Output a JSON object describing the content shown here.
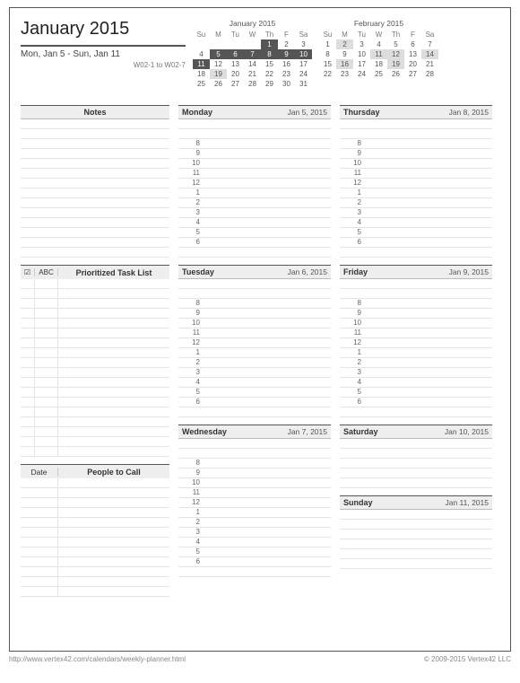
{
  "title": "January 2015",
  "date_range": "Mon, Jan 5  -  Sun, Jan 11",
  "week_numbers": "W02-1 to W02-7",
  "minicals": [
    {
      "title": "January 2015",
      "dow": [
        "Su",
        "M",
        "Tu",
        "W",
        "Th",
        "F",
        "Sa"
      ],
      "rows": [
        [
          "",
          "",
          "",
          "",
          "1",
          "2",
          "3"
        ],
        [
          "4",
          "5",
          "6",
          "7",
          "8",
          "9",
          "10"
        ],
        [
          "11",
          "12",
          "13",
          "14",
          "15",
          "16",
          "17"
        ],
        [
          "18",
          "19",
          "20",
          "21",
          "22",
          "23",
          "24"
        ],
        [
          "25",
          "26",
          "27",
          "28",
          "29",
          "30",
          "31"
        ]
      ],
      "hl_dark": [
        [
          0,
          4
        ],
        [
          1,
          1
        ],
        [
          1,
          2
        ],
        [
          1,
          3
        ],
        [
          1,
          4
        ],
        [
          1,
          5
        ],
        [
          1,
          6
        ],
        [
          2,
          0
        ]
      ],
      "hl_light": [
        [
          3,
          1
        ]
      ]
    },
    {
      "title": "February 2015",
      "dow": [
        "Su",
        "M",
        "Tu",
        "W",
        "Th",
        "F",
        "Sa"
      ],
      "rows": [
        [
          "1",
          "2",
          "3",
          "4",
          "5",
          "6",
          "7"
        ],
        [
          "8",
          "9",
          "10",
          "11",
          "12",
          "13",
          "14"
        ],
        [
          "15",
          "16",
          "17",
          "18",
          "19",
          "20",
          "21"
        ],
        [
          "22",
          "23",
          "24",
          "25",
          "26",
          "27",
          "28"
        ]
      ],
      "hl_dark": [],
      "hl_light": [
        [
          0,
          1
        ],
        [
          1,
          3
        ],
        [
          1,
          4
        ],
        [
          1,
          6
        ],
        [
          2,
          1
        ],
        [
          2,
          4
        ]
      ]
    }
  ],
  "left_sections": {
    "notes": "Notes",
    "task_check": "☑",
    "task_abc": "ABC",
    "task_title": "Prioritized Task List",
    "people_date": "Date",
    "people_title": "People to Call"
  },
  "hours": [
    "8",
    "9",
    "10",
    "11",
    "12",
    "1",
    "2",
    "3",
    "4",
    "5",
    "6"
  ],
  "days": [
    {
      "name": "Monday",
      "date": "Jan 5, 2015"
    },
    {
      "name": "Tuesday",
      "date": "Jan 6, 2015"
    },
    {
      "name": "Wednesday",
      "date": "Jan 7, 2015"
    },
    {
      "name": "Thursday",
      "date": "Jan 8, 2015"
    },
    {
      "name": "Friday",
      "date": "Jan 9, 2015"
    },
    {
      "name": "Saturday",
      "date": "Jan 10, 2015"
    },
    {
      "name": "Sunday",
      "date": "Jan 11, 2015"
    }
  ],
  "footer_left": "http://www.vertex42.com/calendars/weekly-planner.html",
  "footer_right": "© 2009-2015 Vertex42 LLC"
}
